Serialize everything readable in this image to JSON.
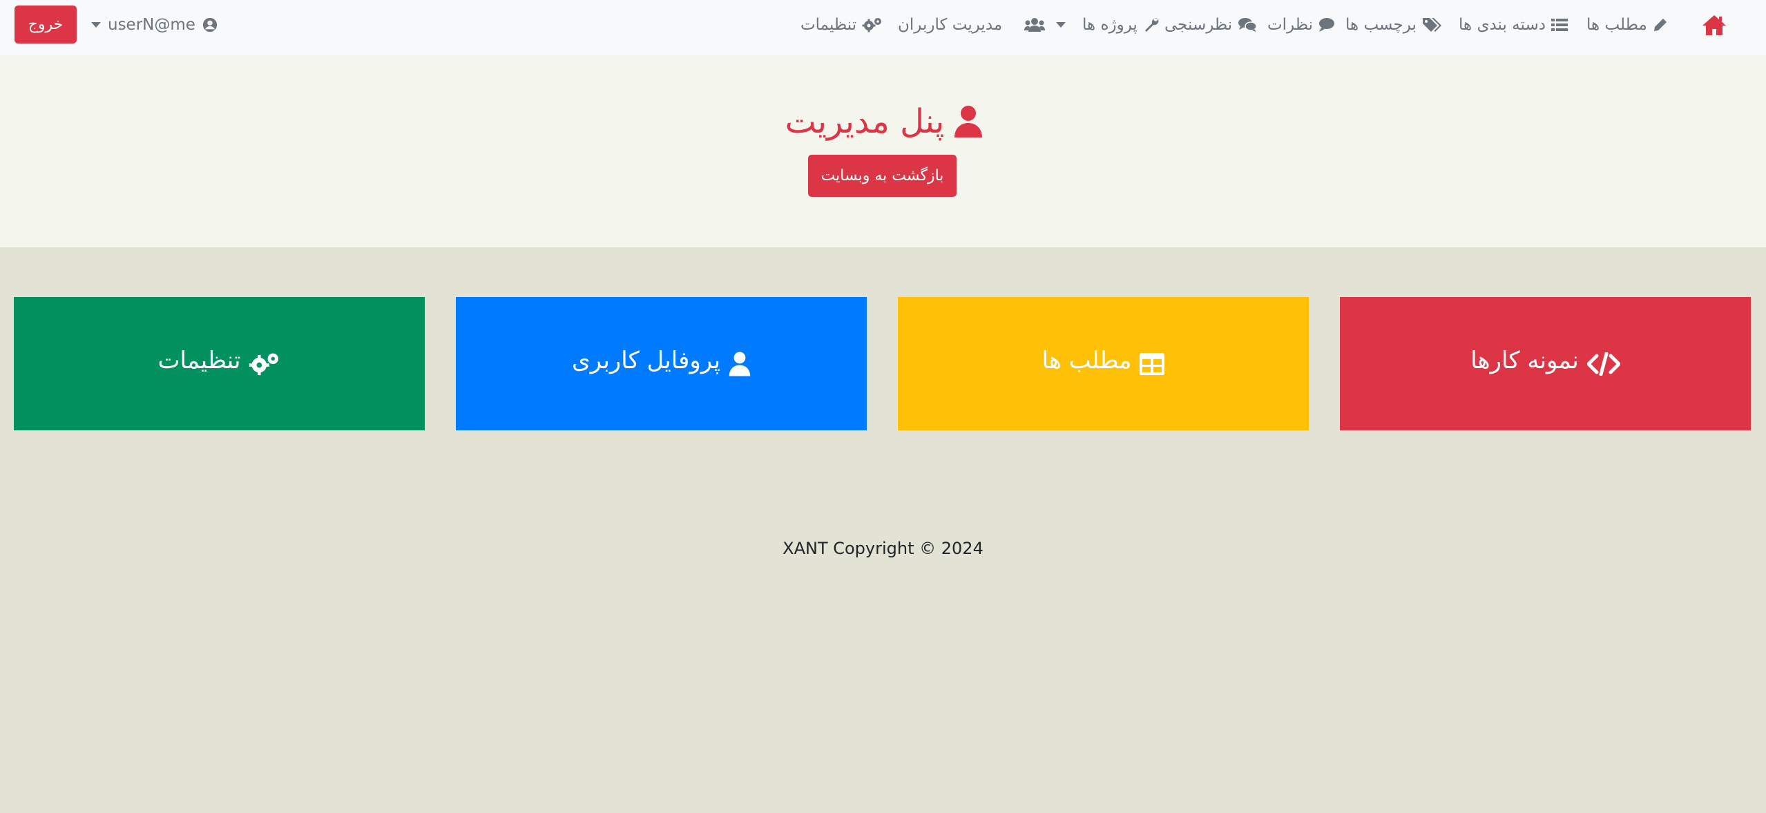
{
  "navbar": {
    "logout_label": "خروج",
    "username": "userN@me",
    "items": [
      {
        "label": "مطلب ها",
        "icon": "pencil-icon"
      },
      {
        "label": "دسته بندی ها",
        "icon": "list-icon"
      },
      {
        "label": "برچسب ها",
        "icon": "tags-icon"
      },
      {
        "label": "نظرات",
        "icon": "comment-icon"
      },
      {
        "label": "نظرسنجی",
        "icon": "comments-icon"
      },
      {
        "label": "پروژه ها",
        "icon": "wrench-icon"
      },
      {
        "label": "مدیریت کاربران",
        "icon": "users-icon"
      },
      {
        "label": "تنظیمات",
        "icon": "cogs-icon"
      }
    ]
  },
  "hero": {
    "title": "پنل مدیریت",
    "back_label": "بازگشت به وبسایت"
  },
  "tiles": [
    {
      "label": "تنظیمات",
      "icon": "cogs-icon",
      "color": "#039160"
    },
    {
      "label": "پروفایل کاربری",
      "icon": "user-icon",
      "color": "#007bff"
    },
    {
      "label": "مطلب ها",
      "icon": "table-icon",
      "color": "#ffc107"
    },
    {
      "label": "نمونه کارها",
      "icon": "code-icon",
      "color": "#dc3545"
    }
  ],
  "footer": {
    "text": "XANT Copyright © 2024"
  },
  "colors": {
    "accent": "#dc3545",
    "navbar_bg": "#f8f9fa",
    "hero_bg": "#f4f6ee",
    "page_bg": "#e2e2d5"
  }
}
